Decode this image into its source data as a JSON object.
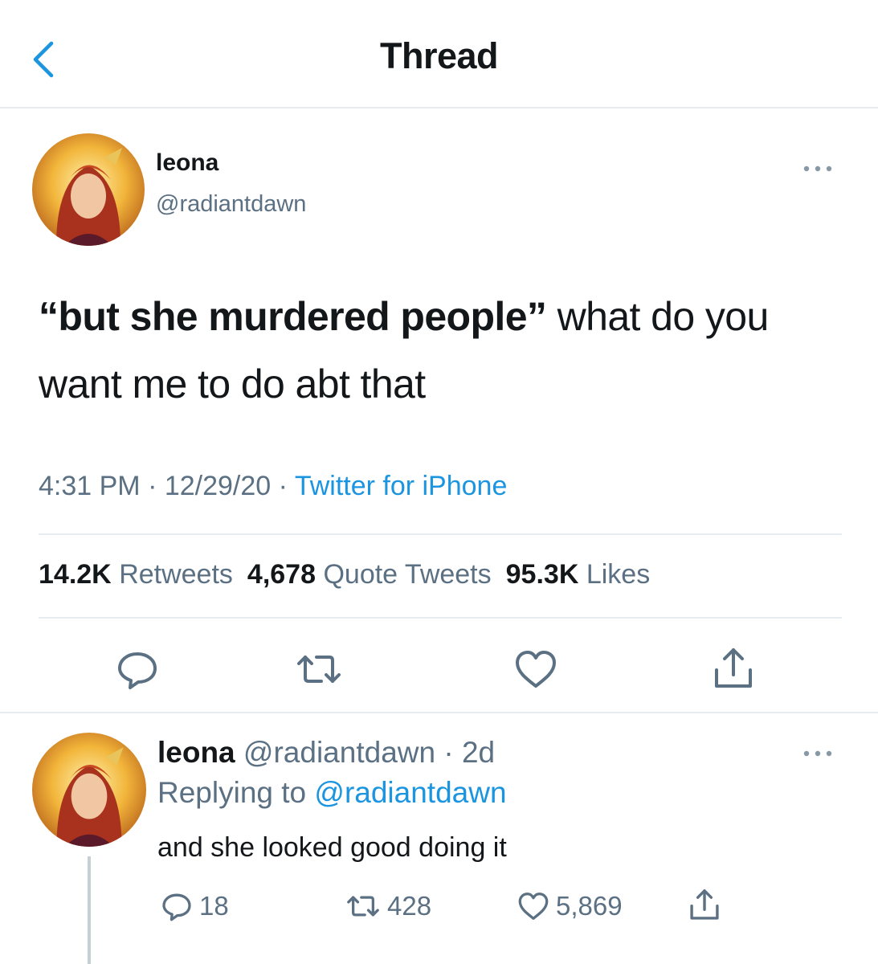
{
  "header": {
    "title": "Thread"
  },
  "tweet": {
    "author_name": "leona",
    "author_handle": "@radiantdawn",
    "text_quote_open": "“",
    "text_bold": "but she murdered people",
    "text_quote_close": "”",
    "text_rest": " what do you want me to do abt that",
    "time": "4:31 PM",
    "date": "12/29/20",
    "sep": " · ",
    "source": "Twitter for iPhone",
    "retweets_count": "14.2K",
    "retweets_label": "Retweets",
    "quotes_count": "4,678",
    "quotes_label": "Quote Tweets",
    "likes_count": "95.3K",
    "likes_label": "Likes"
  },
  "reply": {
    "author_name": "leona",
    "author_handle": "@radiantdawn",
    "age": " · 2d",
    "replying_prefix": "Replying to ",
    "replying_handle": "@radiantdawn",
    "text": "and she looked good doing it",
    "reply_count": "18",
    "retweet_count": "428",
    "like_count": "5,869"
  },
  "icons": {
    "back": "chevron-left-icon",
    "more": "more-horizontal-icon",
    "reply": "comment-icon",
    "retweet": "retweet-icon",
    "like": "heart-icon",
    "share": "share-icon"
  },
  "colors": {
    "accent": "#1b95e0",
    "muted": "#5b7083",
    "text": "#14171a",
    "divider": "#e6ecf0"
  }
}
